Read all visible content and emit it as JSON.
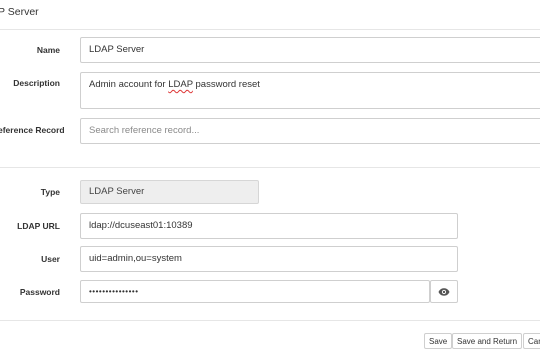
{
  "header": {
    "title": "P Server"
  },
  "form": {
    "name": {
      "label": "Name",
      "value": "LDAP Server"
    },
    "description": {
      "label": "Description",
      "value_pre": "Admin account for ",
      "value_mark": "LDAP",
      "value_post": " password reset"
    },
    "reference": {
      "label": "eference Record",
      "placeholder": "Search reference record..."
    },
    "type": {
      "label": "Type",
      "value": "LDAP Server"
    },
    "ldap_url": {
      "label": "LDAP URL",
      "value": "ldap://dcuseast01:10389"
    },
    "user": {
      "label": "User",
      "value": "uid=admin,ou=system"
    },
    "password": {
      "label": "Password",
      "value": "•••••••••••••••",
      "toggle_icon": "eye-icon"
    }
  },
  "footer": {
    "save_label": "Save",
    "save_return_label": "Save and Return",
    "cancel_label": "Car"
  }
}
